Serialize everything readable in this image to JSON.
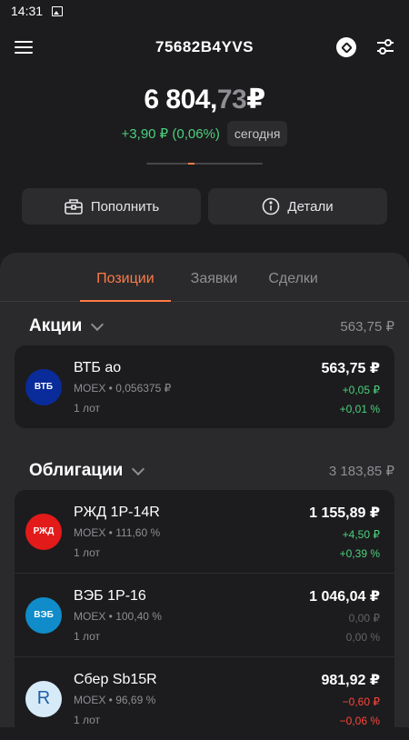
{
  "status_bar": {
    "time": "14:31"
  },
  "header": {
    "account_title": "75682B4YVS"
  },
  "balance": {
    "integer": "6 804,",
    "fraction": "73",
    "currency": "₽",
    "change": "+3,90 ₽ (0,06%)",
    "period": "сегодня"
  },
  "actions": {
    "deposit_label": "Пополнить",
    "details_label": "Детали"
  },
  "tabs": [
    {
      "label": "Позиции",
      "active": true
    },
    {
      "label": "Заявки",
      "active": false
    },
    {
      "label": "Сделки",
      "active": false
    }
  ],
  "sections": {
    "stocks": {
      "title": "Акции",
      "total": "563,75 ₽",
      "items": [
        {
          "name": "ВТБ ао",
          "sub": "MOEX • 0,056375 ₽",
          "lots": "1 лот",
          "value": "563,75 ₽",
          "change_abs": "+0,05 ₽",
          "change_pct": "+0,01 %",
          "logo_text": "ВТБ",
          "logo_color": "#0a2b9a"
        }
      ]
    },
    "bonds": {
      "title": "Облигации",
      "total": "3 183,85 ₽",
      "items": [
        {
          "name": "РЖД 1Р-14R",
          "sub": "MOEX • 111,60 %",
          "lots": "1 лот",
          "value": "1 155,89 ₽",
          "change_abs": "+4,50 ₽",
          "change_pct": "+0,39 %",
          "logo_text": "РЖД",
          "logo_color": "#e21a1a"
        },
        {
          "name": "ВЭБ 1Р-16",
          "sub": "MOEX • 100,40 %",
          "lots": "1 лот",
          "value": "1 046,04 ₽",
          "change_abs": "0,00 ₽",
          "change_pct": "0,00 %",
          "logo_text": "ВЭБ",
          "logo_color": "#0f8cc9"
        },
        {
          "name": "Сбер Sb15R",
          "sub": "MOEX • 96,69 %",
          "lots": "1 лот",
          "value": "981,92 ₽",
          "change_abs": "−0,60 ₽",
          "change_pct": "−0,06 %",
          "logo_text": "R",
          "logo_color": "#d6ebf7"
        }
      ]
    }
  }
}
